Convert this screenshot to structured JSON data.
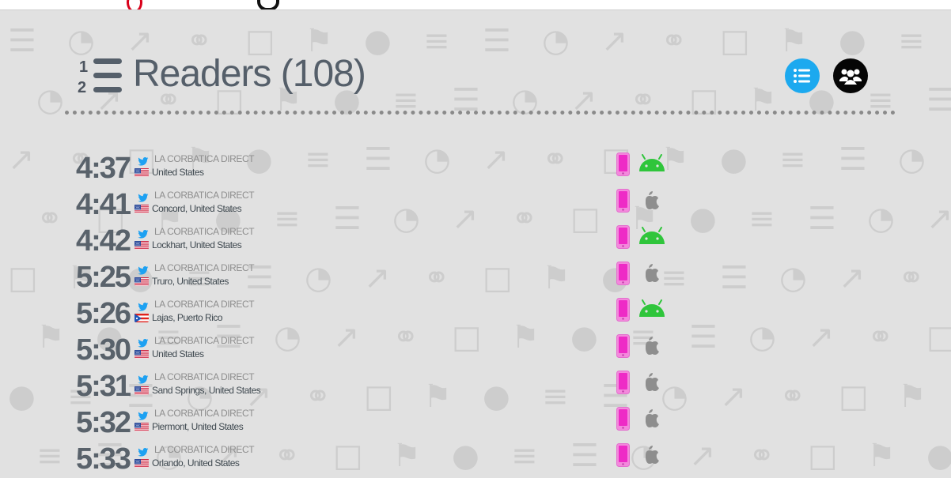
{
  "header": {
    "title": "Readers (108)"
  },
  "view_toggle": {
    "list_icon": "list-icon",
    "people_icon": "people-icon"
  },
  "colors": {
    "list_button": "#1ca9ef",
    "people_button": "#050505",
    "mobile_device": "#ee2bc6",
    "android": "#2fc53b",
    "apple": "#8e8e8e",
    "twitter": "#1da1f2"
  },
  "readers": [
    {
      "time": "4:37",
      "source": "LA CORBATICA DIRECT",
      "source_icon": "twitter-icon",
      "flag": "us",
      "location": "United States",
      "device": "mobile",
      "os": "android"
    },
    {
      "time": "4:41",
      "source": "LA CORBATICA DIRECT",
      "source_icon": "twitter-icon",
      "flag": "us",
      "location": "Concord, United States",
      "device": "mobile",
      "os": "apple"
    },
    {
      "time": "4:42",
      "source": "LA CORBATICA DIRECT",
      "source_icon": "twitter-icon",
      "flag": "us",
      "location": "Lockhart, United States",
      "device": "mobile",
      "os": "android"
    },
    {
      "time": "5:25",
      "source": "LA CORBATICA DIRECT",
      "source_icon": "twitter-icon",
      "flag": "us",
      "location": "Truro, United States",
      "device": "mobile",
      "os": "apple"
    },
    {
      "time": "5:26",
      "source": "LA CORBATICA DIRECT",
      "source_icon": "twitter-icon",
      "flag": "pr",
      "location": "Lajas, Puerto Rico",
      "device": "mobile",
      "os": "android"
    },
    {
      "time": "5:30",
      "source": "LA CORBATICA DIRECT",
      "source_icon": "twitter-icon",
      "flag": "us",
      "location": "United States",
      "device": "mobile",
      "os": "apple"
    },
    {
      "time": "5:31",
      "source": "LA CORBATICA DIRECT",
      "source_icon": "twitter-icon",
      "flag": "us",
      "location": "Sand Springs, United States",
      "device": "mobile",
      "os": "apple"
    },
    {
      "time": "5:32",
      "source": "LA CORBATICA DIRECT",
      "source_icon": "twitter-icon",
      "flag": "us",
      "location": "Piermont, United States",
      "device": "mobile",
      "os": "apple"
    },
    {
      "time": "5:33",
      "source": "LA CORBATICA DIRECT",
      "source_icon": "twitter-icon",
      "flag": "us",
      "location": "Orlando, United States",
      "device": "mobile",
      "os": "apple"
    }
  ]
}
